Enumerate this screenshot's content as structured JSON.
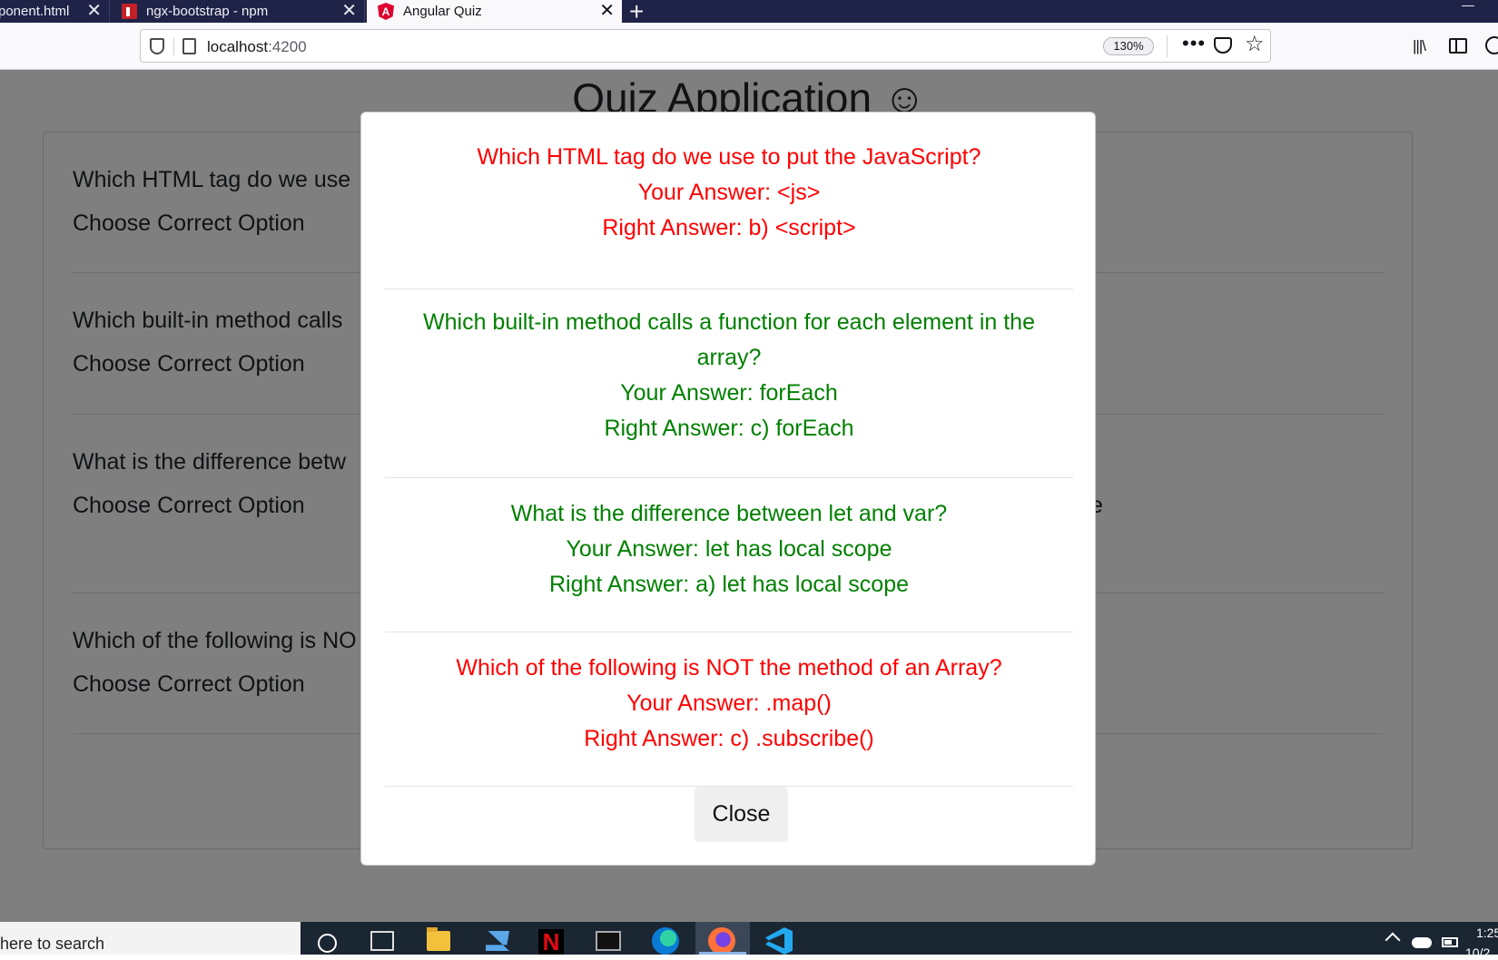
{
  "browser": {
    "tabs": [
      {
        "label": "ponent.html",
        "active": false
      },
      {
        "label": "ngx-bootstrap - npm",
        "active": false
      },
      {
        "label": "Angular Quiz",
        "active": true
      }
    ],
    "url_host": "localhost",
    "url_port": ":4200",
    "zoom": "130%"
  },
  "page": {
    "title": "Quiz Application ☺",
    "questions": [
      {
        "text": "Which HTML tag do we use",
        "prompt": "Choose Correct Option"
      },
      {
        "text": "Which built-in method calls",
        "prompt": "Choose Correct Option"
      },
      {
        "text": "What is the difference betw",
        "prompt": "Choose Correct Option",
        "right_fragment": "e"
      },
      {
        "text": "Which of the following is NO",
        "prompt": "Choose Correct Option"
      }
    ]
  },
  "modal": {
    "results": [
      {
        "question": "Which HTML tag do we use to put the JavaScript?",
        "your_answer": "Your Answer: <js>",
        "right_answer": "Right Answer: b) <script>",
        "status": "wrong"
      },
      {
        "question": "Which built-in method calls a function for each element in the array?",
        "your_answer": "Your Answer: forEach",
        "right_answer": "Right Answer: c) forEach",
        "status": "right"
      },
      {
        "question": "What is the difference between let and var?",
        "your_answer": "Your Answer: let has local scope",
        "right_answer": "Right Answer: a) let has local scope",
        "status": "right"
      },
      {
        "question": "Which of the following is NOT the method of an Array?",
        "your_answer": "Your Answer: .map()",
        "right_answer": "Right Answer: c) .subscribe()",
        "status": "wrong"
      }
    ],
    "close_label": "Close"
  },
  "taskbar": {
    "search_text": "here to search",
    "clock_time": "1:25",
    "clock_date": "10/2"
  },
  "colors": {
    "wrong": "#ff0000",
    "right": "#008000",
    "tabstrip": "#1f2348",
    "taskbar": "#1b2633"
  }
}
